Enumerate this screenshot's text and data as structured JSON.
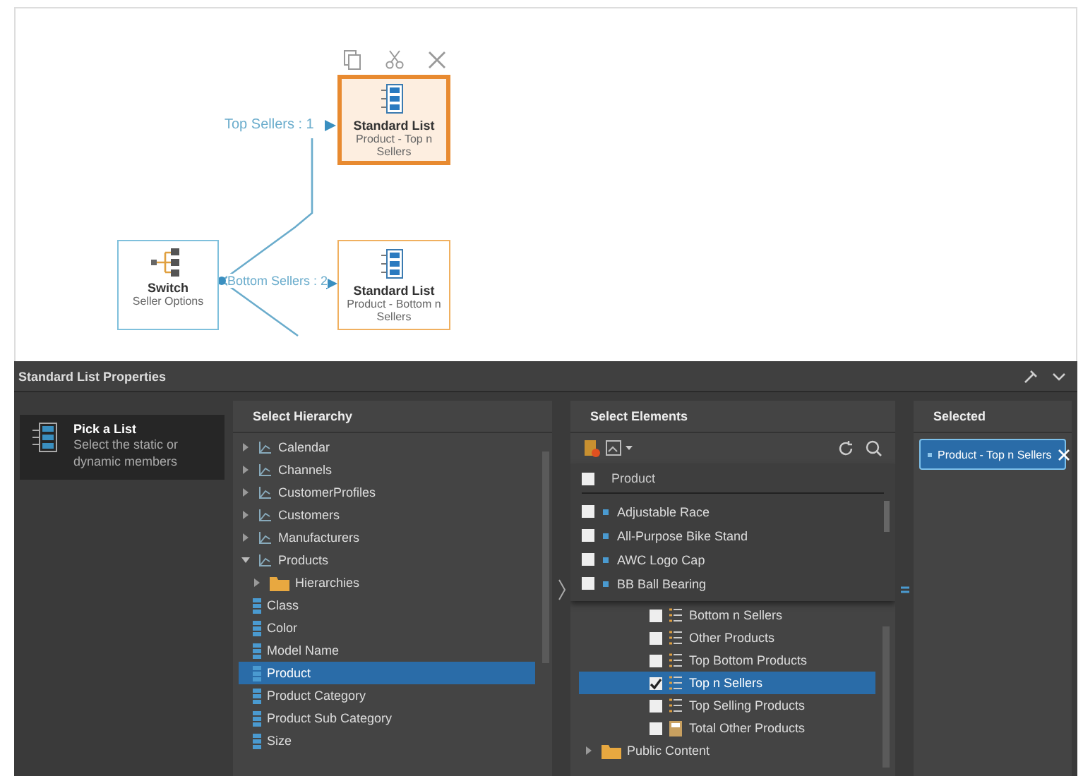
{
  "canvas": {
    "toolbar": [
      {
        "kind": "copy"
      },
      {
        "kind": "cut"
      },
      {
        "kind": "close"
      }
    ],
    "nodes": [
      {
        "kind": "list",
        "title": "Standard List",
        "subtitle": "Product - Top n Sellers",
        "selected": true
      },
      {
        "kind": "switch",
        "title": "Switch",
        "subtitle": "Seller Options",
        "selected": false
      },
      {
        "kind": "list",
        "title": "Standard List",
        "subtitle": "Product - Bottom n Sellers",
        "selected": false
      }
    ],
    "branches": [
      "Top Sellers : 1",
      "Bottom Sellers : 2"
    ]
  },
  "panel": {
    "title": "Standard List Properties",
    "steps": [
      {
        "title": "Pick a List",
        "description": "Select the static or dynamic members",
        "selected": true
      }
    ],
    "hierarchy": {
      "header": "Select Hierarchy",
      "items": [
        {
          "kind": "dimension",
          "label": "Calendar",
          "expanded": false,
          "selected": false
        },
        {
          "kind": "dimension",
          "label": "Channels",
          "expanded": false,
          "selected": false
        },
        {
          "kind": "dimension",
          "label": "CustomerProfiles",
          "expanded": false,
          "selected": false
        },
        {
          "kind": "dimension",
          "label": "Customers",
          "expanded": false,
          "selected": false
        },
        {
          "kind": "dimension",
          "label": "Manufacturers",
          "expanded": false,
          "selected": false
        },
        {
          "kind": "dimension",
          "label": "Products",
          "expanded": true,
          "selected": false,
          "children": [
            {
              "kind": "folder",
              "label": "Hierarchies",
              "expanded": false,
              "selected": false
            },
            {
              "kind": "attribute",
              "label": "Class",
              "selected": false
            },
            {
              "kind": "attribute",
              "label": "Color",
              "selected": false
            },
            {
              "kind": "attribute",
              "label": "Model Name",
              "selected": false
            },
            {
              "kind": "attribute",
              "label": "Product",
              "selected": true
            },
            {
              "kind": "attribute",
              "label": "Product Category",
              "selected": false
            },
            {
              "kind": "attribute",
              "label": "Product Sub Category",
              "selected": false
            },
            {
              "kind": "attribute",
              "label": "Size",
              "selected": false
            }
          ]
        }
      ]
    },
    "elements": {
      "header": "Select Elements",
      "popup": {
        "header": {
          "label": "Product",
          "checked": false
        },
        "members": [
          {
            "label": "Adjustable Race",
            "checked": false
          },
          {
            "label": "All-Purpose Bike Stand",
            "checked": false
          },
          {
            "label": "AWC Logo Cap",
            "checked": false
          },
          {
            "label": "BB Ball Bearing",
            "checked": false
          }
        ]
      },
      "items": [
        {
          "kind": "set",
          "label": "Bottom n Sellers",
          "checked": false,
          "selected": false
        },
        {
          "kind": "set",
          "label": "Other Products",
          "checked": false,
          "selected": false
        },
        {
          "kind": "set",
          "label": "Top Bottom Products",
          "checked": false,
          "selected": false
        },
        {
          "kind": "set",
          "label": "Top n Sellers",
          "checked": true,
          "selected": true
        },
        {
          "kind": "set",
          "label": "Top Selling Products",
          "checked": false,
          "selected": false
        },
        {
          "kind": "calc",
          "label": "Total Other Products",
          "checked": false,
          "selected": false
        }
      ],
      "folders": [
        {
          "label": "Public Content",
          "expanded": false
        }
      ]
    },
    "selected": {
      "header": "Selected",
      "chips": [
        "Product - Top n Sellers"
      ]
    }
  }
}
